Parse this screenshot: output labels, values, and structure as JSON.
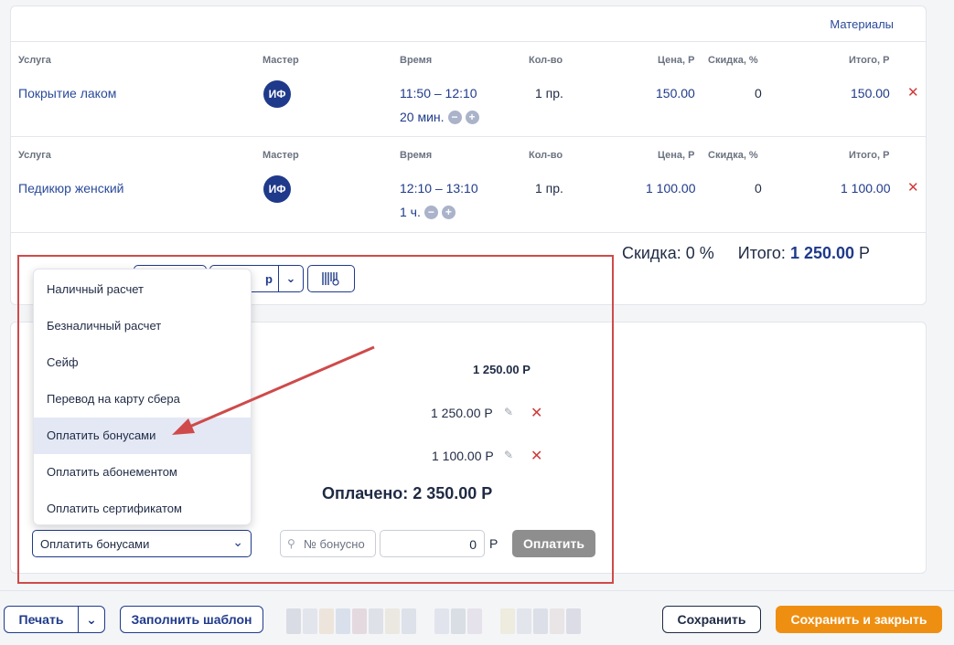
{
  "materials": "Материалы",
  "headers": {
    "service": "Услуга",
    "master": "Мастер",
    "time": "Время",
    "qty": "Кол-во",
    "price": "Цена, Р",
    "discount": "Скидка, %",
    "total": "Итого, Р"
  },
  "services": [
    {
      "name": "Покрытие лаком",
      "master": "ИФ",
      "time": "11:50 – 12:10",
      "duration": "20 мин.",
      "qty": "1 пр.",
      "price": "150.00",
      "discount": "0",
      "total": "150.00",
      "delete": "✕"
    },
    {
      "name": "Педикюр женский",
      "master": "ИФ",
      "time": "12:10 – 13:10",
      "duration": "1 ч.",
      "qty": "1 пр.",
      "price": "1 100.00",
      "discount": "0",
      "total": "1 100.00",
      "delete": "✕"
    }
  ],
  "summary": {
    "discount_label": "Скидка: 0 %",
    "total_label": "Итого:",
    "total_value": "1 250.00",
    "currency": "Р"
  },
  "partial_button": "р",
  "payments": {
    "due": "1 250.00 Р",
    "rows": [
      {
        "amount": "1 250.00 Р"
      },
      {
        "amount": "1 100.00 Р"
      }
    ],
    "paid": "Оплачено: 2 350.00 Р"
  },
  "dropdown": {
    "items": [
      "Наличный расчет",
      "Безналичный расчет",
      "Сейф",
      "Перевод на карту сбера",
      "Оплатить бонусами",
      "Оплатить абонементом",
      "Оплатить сертификатом"
    ],
    "active_index": 4,
    "selected": "Оплатить бонусами"
  },
  "bonus_placeholder": "№ бонусно",
  "amount_value": "0",
  "currency_short": "Р",
  "pay_button": "Оплатить",
  "footer": {
    "print": "Печать",
    "template": "Заполнить шаблон",
    "save": "Сохранить",
    "save_close": "Сохранить и закрыть"
  },
  "colors": {
    "accent": "#1f3a8a",
    "orange": "#ef8f11",
    "danger": "#d03a3a",
    "highlight": "#cf4a4a"
  }
}
